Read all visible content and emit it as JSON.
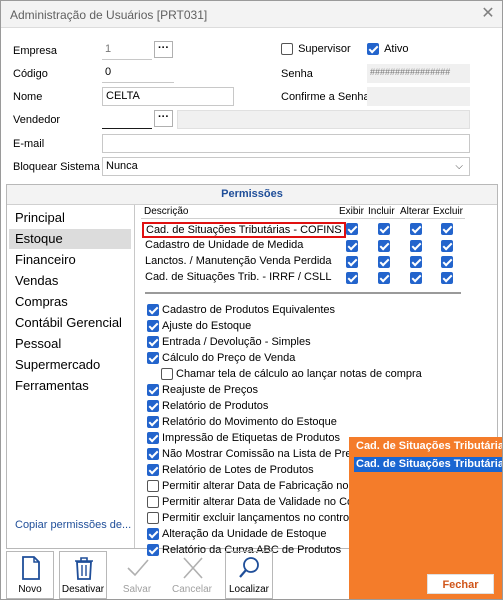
{
  "window": {
    "title": "Administração de Usuários [PRT031]",
    "close_glyph": "✕"
  },
  "form": {
    "empresa": {
      "label": "Empresa",
      "value": "1"
    },
    "codigo": {
      "label": "Código",
      "value": "0"
    },
    "nome": {
      "label": "Nome",
      "value": "CELTA"
    },
    "vendedor": {
      "label": "Vendedor",
      "value": ""
    },
    "email": {
      "label": "E-mail",
      "value": ""
    },
    "bloquear": {
      "label": "Bloquear Sistema",
      "value": "Nunca"
    },
    "supervisor": {
      "label": "Supervisor",
      "checked": false
    },
    "ativo": {
      "label": "Ativo",
      "checked": true
    },
    "senha": {
      "label": "Senha",
      "value": "################"
    },
    "confirme": {
      "label": "Confirme a Senha",
      "value": ""
    },
    "dots_label": "···"
  },
  "permissions": {
    "header": "Permissões",
    "categories": [
      "Principal",
      "Estoque",
      "Financeiro",
      "Vendas",
      "Compras",
      "Contábil Gerencial",
      "Pessoal",
      "Supermercado",
      "Ferramentas"
    ],
    "selected_category": "Estoque",
    "copy_link": "Copiar permissões de...",
    "grid": {
      "headers": {
        "descricao": "Descrição",
        "exibir": "Exibir",
        "incluir": "Incluir",
        "alterar": "Alterar",
        "excluir": "Excluir"
      },
      "rows": [
        {
          "name": "Cad. de Situações Tributárias - COFINS",
          "highlighted": true
        },
        {
          "name": "Cadastro de Unidade de Medida"
        },
        {
          "name": "Lanctos. / Manutenção Venda Perdida"
        },
        {
          "name": "Cad. de Situações Trib. - IRRF / CSLL"
        }
      ]
    },
    "checks": [
      {
        "label": "Cadastro de Produtos Equivalentes",
        "checked": true,
        "indent": 0
      },
      {
        "label": "Ajuste do Estoque",
        "checked": true,
        "indent": 0
      },
      {
        "label": "Entrada / Devolução - Simples",
        "checked": true,
        "indent": 0
      },
      {
        "label": "Cálculo do Preço de Venda",
        "checked": true,
        "indent": 0
      },
      {
        "label": "Chamar tela de cálculo ao lançar notas de compra",
        "checked": false,
        "indent": 1
      },
      {
        "label": "Reajuste de Preços",
        "checked": true,
        "indent": 0
      },
      {
        "label": "Relatório de Produtos",
        "checked": true,
        "indent": 0
      },
      {
        "label": "Relatório do Movimento do Estoque",
        "checked": true,
        "indent": 0
      },
      {
        "label": "Impressão de Etiquetas de Produtos",
        "checked": true,
        "indent": 0
      },
      {
        "label": "Não Mostrar Comissão na Lista de Preços",
        "checked": true,
        "indent": 0
      },
      {
        "label": "Relatório de Lotes de Produtos",
        "checked": true,
        "indent": 0
      },
      {
        "label": "Permitir alterar Data de Fabricação no Co",
        "checked": false,
        "indent": 0
      },
      {
        "label": "Permitir alterar Data de Validade no Cont",
        "checked": false,
        "indent": 0
      },
      {
        "label": "Permitir excluir lançamentos no controle c",
        "checked": false,
        "indent": 0
      },
      {
        "label": "Alteração da Unidade de Estoque",
        "checked": true,
        "indent": 0
      },
      {
        "label": "Relatório da Curva  ABC de Produtos",
        "checked": true,
        "indent": 0
      }
    ]
  },
  "toolbar": {
    "novo": "Novo",
    "desativar": "Desativar",
    "salvar": "Salvar",
    "cancelar": "Cancelar",
    "localizar": "Localizar",
    "icons": [
      "document-icon",
      "trash-icon",
      "check-icon",
      "x-icon",
      "search-icon"
    ]
  },
  "popup": {
    "rows": [
      "Cad. de Situações Tributárias - COFINS",
      "Cad. de Situações Tributárias - COFINS"
    ],
    "fechar": "Fechar",
    "color": "#f47c2a"
  }
}
